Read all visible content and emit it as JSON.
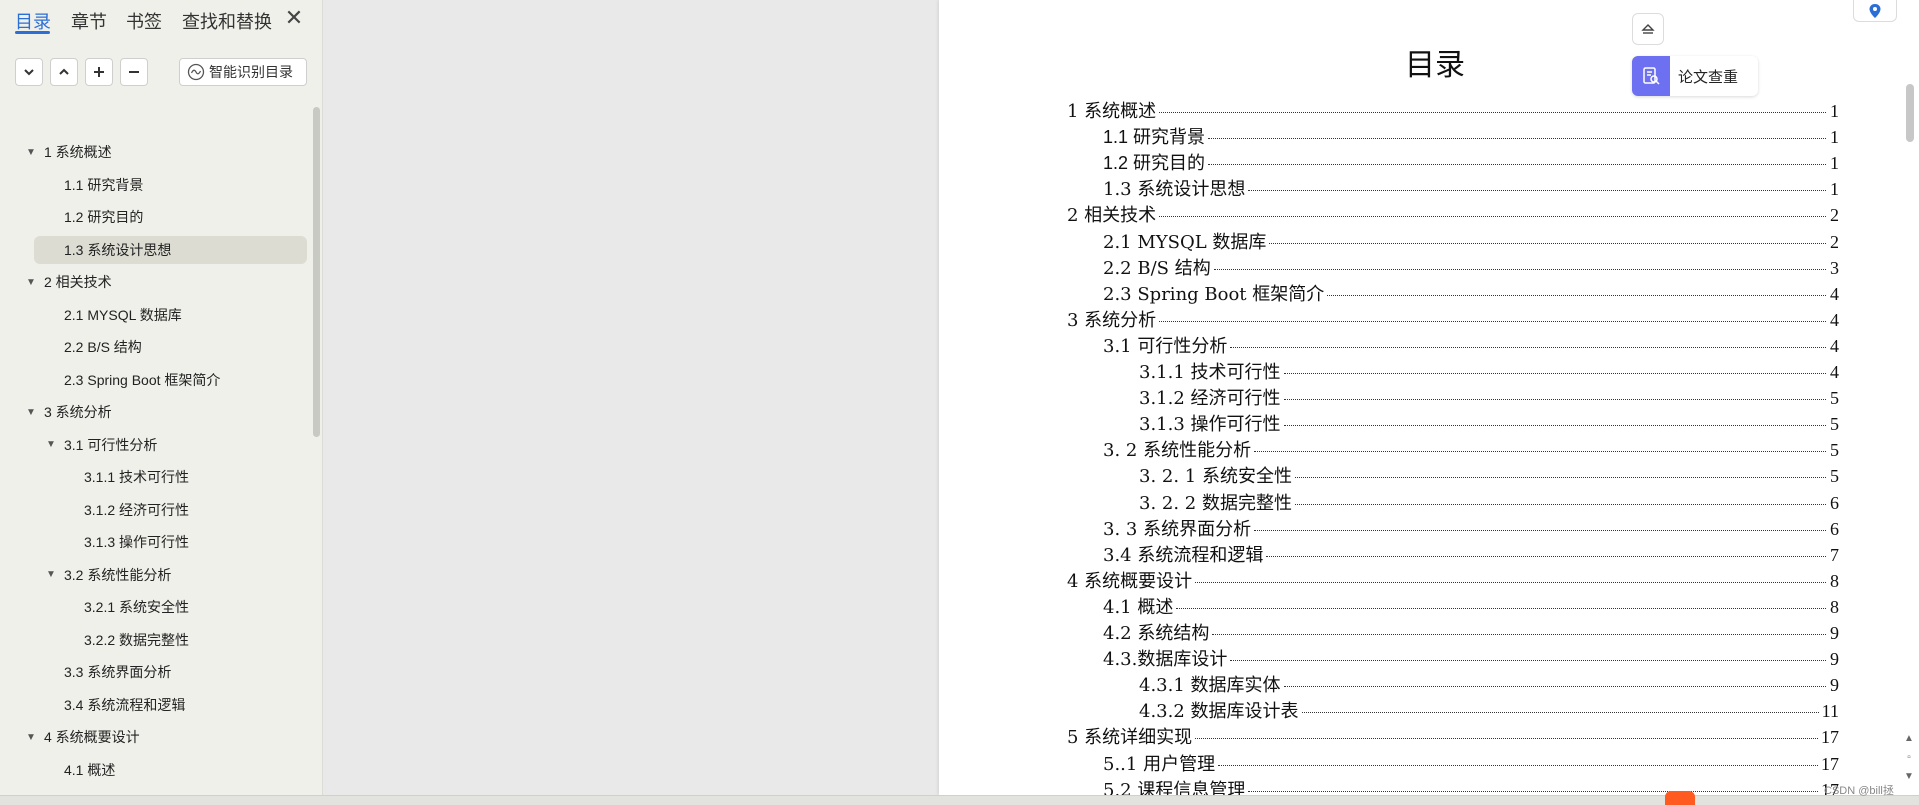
{
  "sidebar": {
    "tabs": [
      {
        "label": "目录",
        "active": true
      },
      {
        "label": "章节",
        "active": false
      },
      {
        "label": "书签",
        "active": false
      },
      {
        "label": "查找和替换",
        "active": false
      }
    ],
    "close_icon": "close-icon",
    "controls": [
      "chevron-down-icon",
      "chevron-up-icon",
      "plus-icon",
      "minus-icon"
    ],
    "smart_button_label": "智能识别目录",
    "tree": [
      {
        "label": "1 系统概述",
        "level": 0,
        "expanded": true
      },
      {
        "label": "1.1  研究背景",
        "level": 1
      },
      {
        "label": "1.2 研究目的",
        "level": 1
      },
      {
        "label": "1.3 系统设计思想",
        "level": 1,
        "selected": true
      },
      {
        "label": "2 相关技术",
        "level": 0,
        "expanded": true
      },
      {
        "label": "2.1 MYSQL 数据库",
        "level": 1
      },
      {
        "label": "2.2 B/S 结构",
        "level": 1
      },
      {
        "label": "2.3 Spring Boot 框架简介",
        "level": 1
      },
      {
        "label": "3 系统分析",
        "level": 0,
        "expanded": true
      },
      {
        "label": "3.1 可行性分析",
        "level": 1,
        "expanded": true
      },
      {
        "label": "3.1.1 技术可行性",
        "level": 2
      },
      {
        "label": "3.1.2 经济可行性",
        "level": 2
      },
      {
        "label": "3.1.3 操作可行性",
        "level": 2
      },
      {
        "label": "3.2 系统性能分析",
        "level": 1,
        "expanded": true
      },
      {
        "label": "3.2.1  系统安全性",
        "level": 2
      },
      {
        "label": "3.2.2  数据完整性",
        "level": 2
      },
      {
        "label": "3.3 系统界面分析",
        "level": 1
      },
      {
        "label": "3.4 系统流程和逻辑",
        "level": 1
      },
      {
        "label": "4 系统概要设计",
        "level": 0,
        "expanded": true
      },
      {
        "label": "4.1 概述",
        "level": 1
      }
    ]
  },
  "document": {
    "title": "目录",
    "entries": [
      {
        "text": "1 系统概述",
        "page": "1",
        "level": 0
      },
      {
        "text": "1.1  研究背景",
        "page": "1",
        "level": 1,
        "sans": true
      },
      {
        "text": "1.2 研究目的",
        "page": "1",
        "level": 1,
        "sans": true
      },
      {
        "text": "1.3 系统设计思想",
        "page": "1",
        "level": 1
      },
      {
        "text": "2 相关技术",
        "page": "2",
        "level": 0
      },
      {
        "text": "2.1 MYSQL 数据库",
        "page": "2",
        "level": 1
      },
      {
        "text": "2.2 B/S 结构",
        "page": "3",
        "level": 1
      },
      {
        "text": "2.3 Spring Boot 框架简介",
        "page": "4",
        "level": 1
      },
      {
        "text": "3 系统分析",
        "page": "4",
        "level": 0
      },
      {
        "text": "3.1 可行性分析",
        "page": "4",
        "level": 1
      },
      {
        "text": "3.1.1 技术可行性",
        "page": "4",
        "level": 2
      },
      {
        "text": "3.1.2 经济可行性",
        "page": "5",
        "level": 2
      },
      {
        "text": "3.1.3 操作可行性",
        "page": "5",
        "level": 2
      },
      {
        "text": "3. 2 系统性能分析",
        "page": "5",
        "level": 1
      },
      {
        "text": "3. 2. 1  系统安全性",
        "page": "5",
        "level": 2
      },
      {
        "text": "3. 2. 2  数据完整性",
        "page": "6",
        "level": 2
      },
      {
        "text": "3. 3 系统界面分析",
        "page": "6",
        "level": 1
      },
      {
        "text": "3.4 系统流程和逻辑",
        "page": "7",
        "level": 1
      },
      {
        "text": "4 系统概要设计",
        "page": "8",
        "level": 0
      },
      {
        "text": "4.1 概述",
        "page": "8",
        "level": 1
      },
      {
        "text": "4.2 系统结构",
        "page": "9",
        "level": 1
      },
      {
        "text": "4.3.数据库设计",
        "page": "9",
        "level": 1
      },
      {
        "text": "4.3.1 数据库实体",
        "page": "9",
        "level": 2
      },
      {
        "text": "4.3.2 数据库设计表",
        "page": "11",
        "level": 2
      },
      {
        "text": "5 系统详细实现",
        "page": "17",
        "level": 0
      },
      {
        "text": "5..1  用户管理",
        "page": "17",
        "level": 1
      },
      {
        "text": "5.2  课程信息管理",
        "page": "17",
        "level": 1
      }
    ]
  },
  "right_panel": {
    "collapse_icon": "collapse-panel-icon",
    "paper_check_label": "论文查重",
    "location_icon": "location-pin-icon"
  },
  "colors": {
    "accent": "#2b6fd6",
    "sidebar_bg": "#f0f0eb",
    "selected_bg": "#dcdcd3",
    "paper_check_icon_bg": "#6d70f0"
  },
  "watermark": "CSDN @bill拯"
}
